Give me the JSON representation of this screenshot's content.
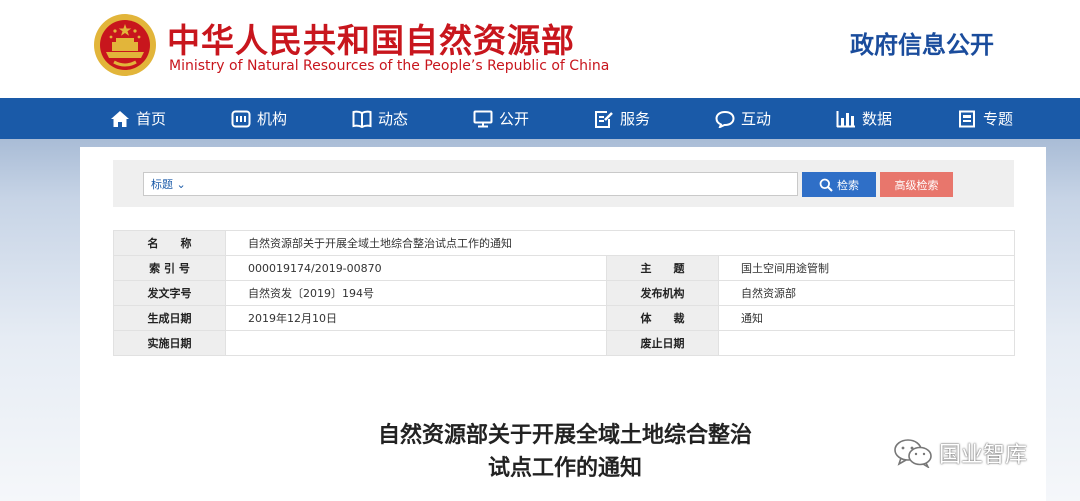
{
  "header": {
    "title_cn": "中华人民共和国自然资源部",
    "title_en": "Ministry of Natural Resources of the People’s Republic of China",
    "gov_info_link": "政府信息公开"
  },
  "nav": {
    "items": [
      {
        "label": "首页",
        "icon": "home-icon"
      },
      {
        "label": "机构",
        "icon": "org-icon"
      },
      {
        "label": "动态",
        "icon": "book-icon"
      },
      {
        "label": "公开",
        "icon": "monitor-icon"
      },
      {
        "label": "服务",
        "icon": "edit-icon"
      },
      {
        "label": "互动",
        "icon": "chat-icon"
      },
      {
        "label": "数据",
        "icon": "bar-chart-icon"
      },
      {
        "label": "专题",
        "icon": "document-icon"
      }
    ]
  },
  "search": {
    "scope": "标题",
    "search_button": "检索",
    "advanced_button": "高级检索"
  },
  "metadata": {
    "name_label": "名　　称",
    "name_value": "自然资源部关于开展全域土地综合整治试点工作的通知",
    "index_label": "索 引 号",
    "index_value": "000019174/2019-00870",
    "subject_label": "主　　题",
    "subject_value": "国土空间用途管制",
    "doc_no_label": "发文字号",
    "doc_no_value": "自然资发〔2019〕194号",
    "issuer_label": "发布机构",
    "issuer_value": "自然资源部",
    "date_label": "生成日期",
    "date_value": "2019年12月10日",
    "genre_label": "体　　裁",
    "genre_value": "通知",
    "impl_label": "实施日期",
    "impl_value": "",
    "repeal_label": "废止日期",
    "repeal_value": ""
  },
  "document": {
    "title_line1": "自然资源部关于开展全域土地综合整治",
    "title_line2": "试点工作的通知"
  },
  "watermark": {
    "text": "国业智库"
  },
  "colors": {
    "brand_red": "#c8161d",
    "nav_blue": "#1a5aa8",
    "search_blue": "#2f6fc7",
    "advanced_red": "#e8766c"
  }
}
